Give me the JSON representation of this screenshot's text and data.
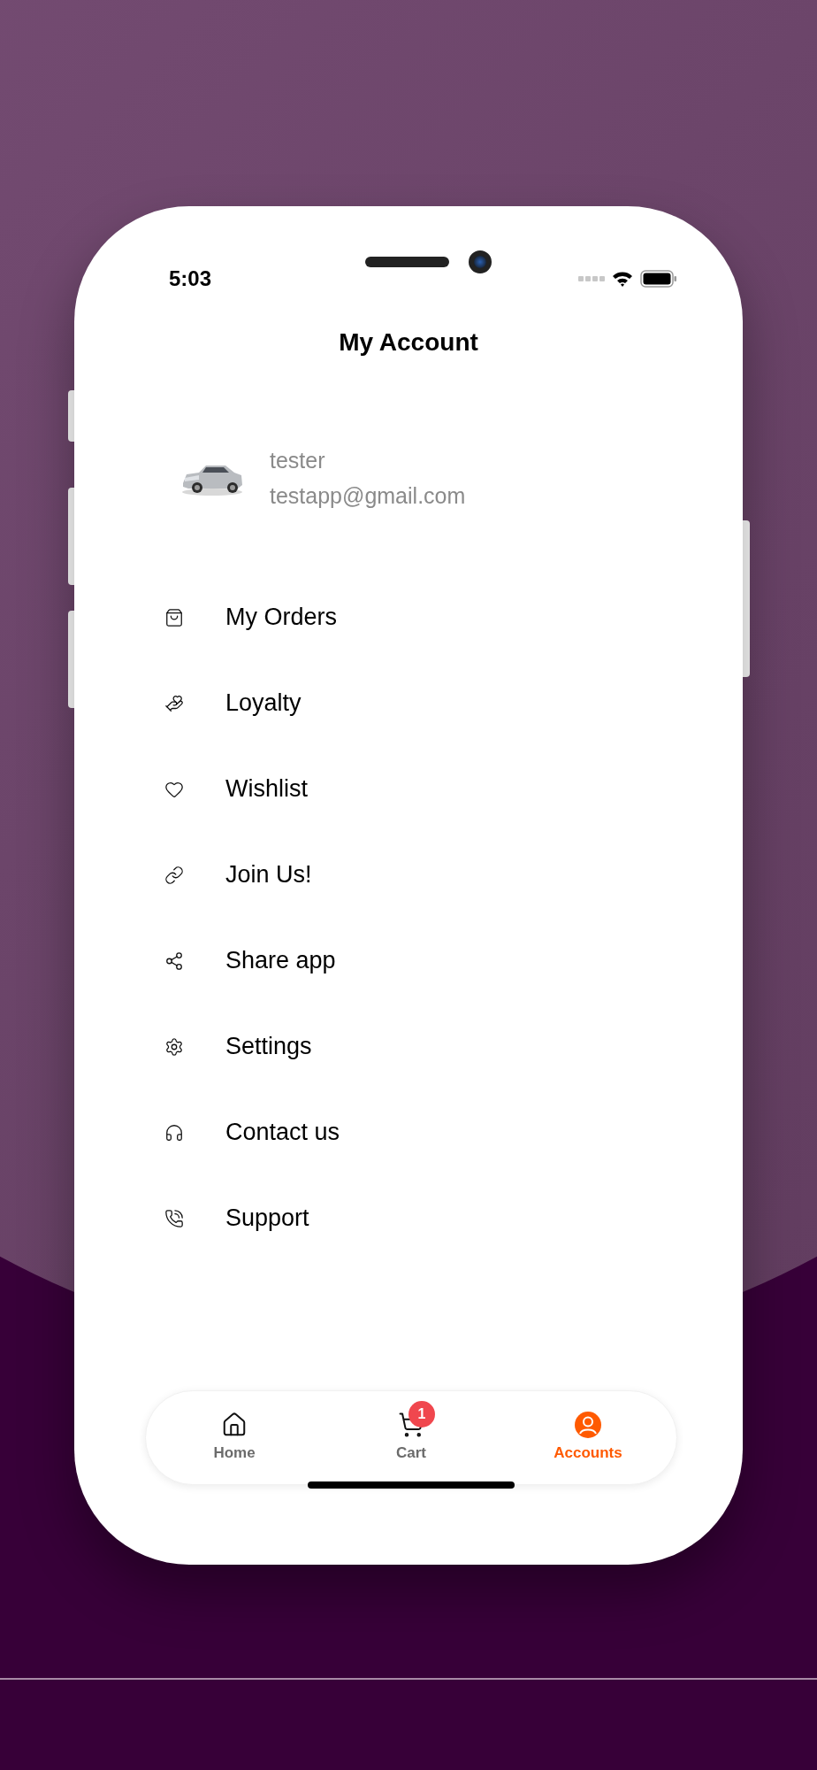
{
  "status_bar": {
    "time": "5:03"
  },
  "header": {
    "title": "My Account"
  },
  "profile": {
    "name": "tester",
    "email": "testapp@gmail.com"
  },
  "menu": [
    {
      "label": "My Orders"
    },
    {
      "label": "Loyalty"
    },
    {
      "label": "Wishlist"
    },
    {
      "label": "Join Us!"
    },
    {
      "label": "Share app"
    },
    {
      "label": "Settings"
    },
    {
      "label": "Contact us"
    },
    {
      "label": "Support"
    }
  ],
  "bottom_nav": [
    {
      "label": "Home",
      "selected": false
    },
    {
      "label": "Cart",
      "selected": false,
      "badge": "1"
    },
    {
      "label": "Accounts",
      "selected": true
    }
  ]
}
